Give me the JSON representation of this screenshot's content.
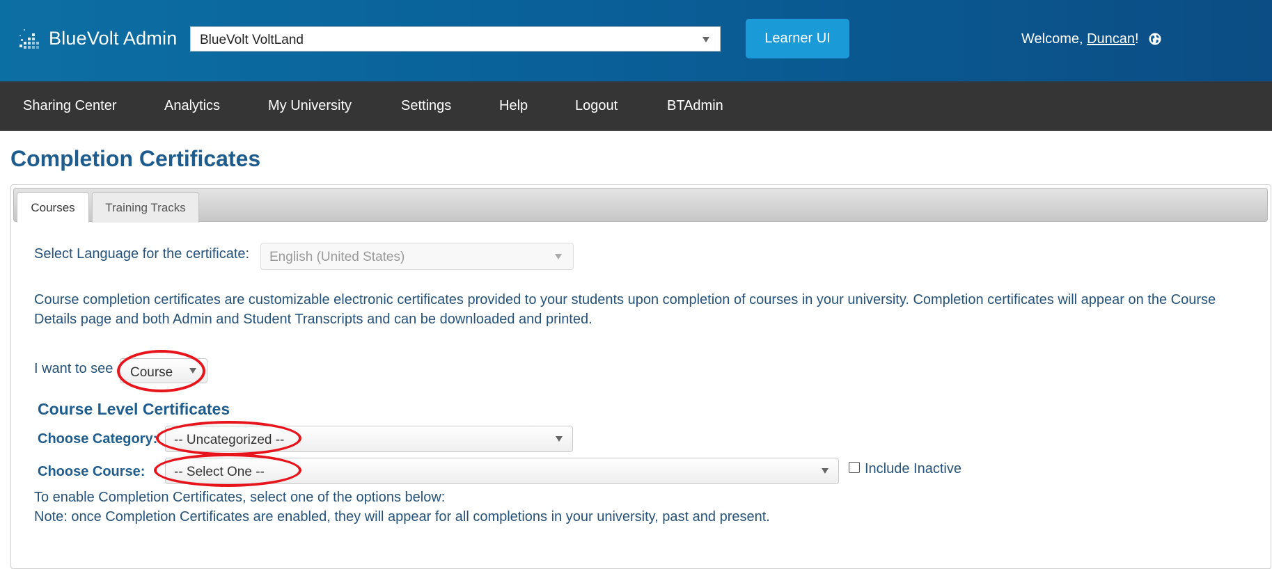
{
  "header": {
    "app_title": "BlueVolt Admin",
    "university_select": "BlueVolt VoltLand",
    "learner_button": "Learner UI",
    "welcome_prefix": "Welcome, ",
    "user_name": "Duncan",
    "welcome_suffix": "!"
  },
  "nav": {
    "items": [
      "Sharing Center",
      "Analytics",
      "My University",
      "Settings",
      "Help",
      "Logout",
      "BTAdmin"
    ]
  },
  "page": {
    "title": "Completion Certificates",
    "tabs": [
      {
        "label": "Courses",
        "active": true
      },
      {
        "label": "Training Tracks",
        "active": false
      }
    ],
    "language_label": "Select Language for the certificate:",
    "language_value": "English (United States)",
    "description": "Course completion certificates are customizable electronic certificates provided to your students upon completion of courses in your university. Completion certificates will appear on the Course Details page and both Admin and Student Transcripts and can be downloaded and printed.",
    "want_to_see_label": "I want to see",
    "want_to_see_value": "Course",
    "section_title": "Course Level Certificates",
    "category_label": "Choose Category:",
    "category_value": "-- Uncategorized --",
    "course_label": "Choose Course:",
    "course_value": "-- Select One --",
    "include_inactive_label": "Include Inactive",
    "enable_text": "To enable Completion Certificates, select one of the options below:",
    "note_text": "Note: once Completion Certificates are enabled, they will appear for all completions in your university, past and present."
  },
  "colors": {
    "header_blue": "#0a6099",
    "nav_bg": "#353535",
    "button_blue": "#1a9ad6",
    "title_blue": "#1f5c8e",
    "annotation_red": "#e8141b"
  }
}
